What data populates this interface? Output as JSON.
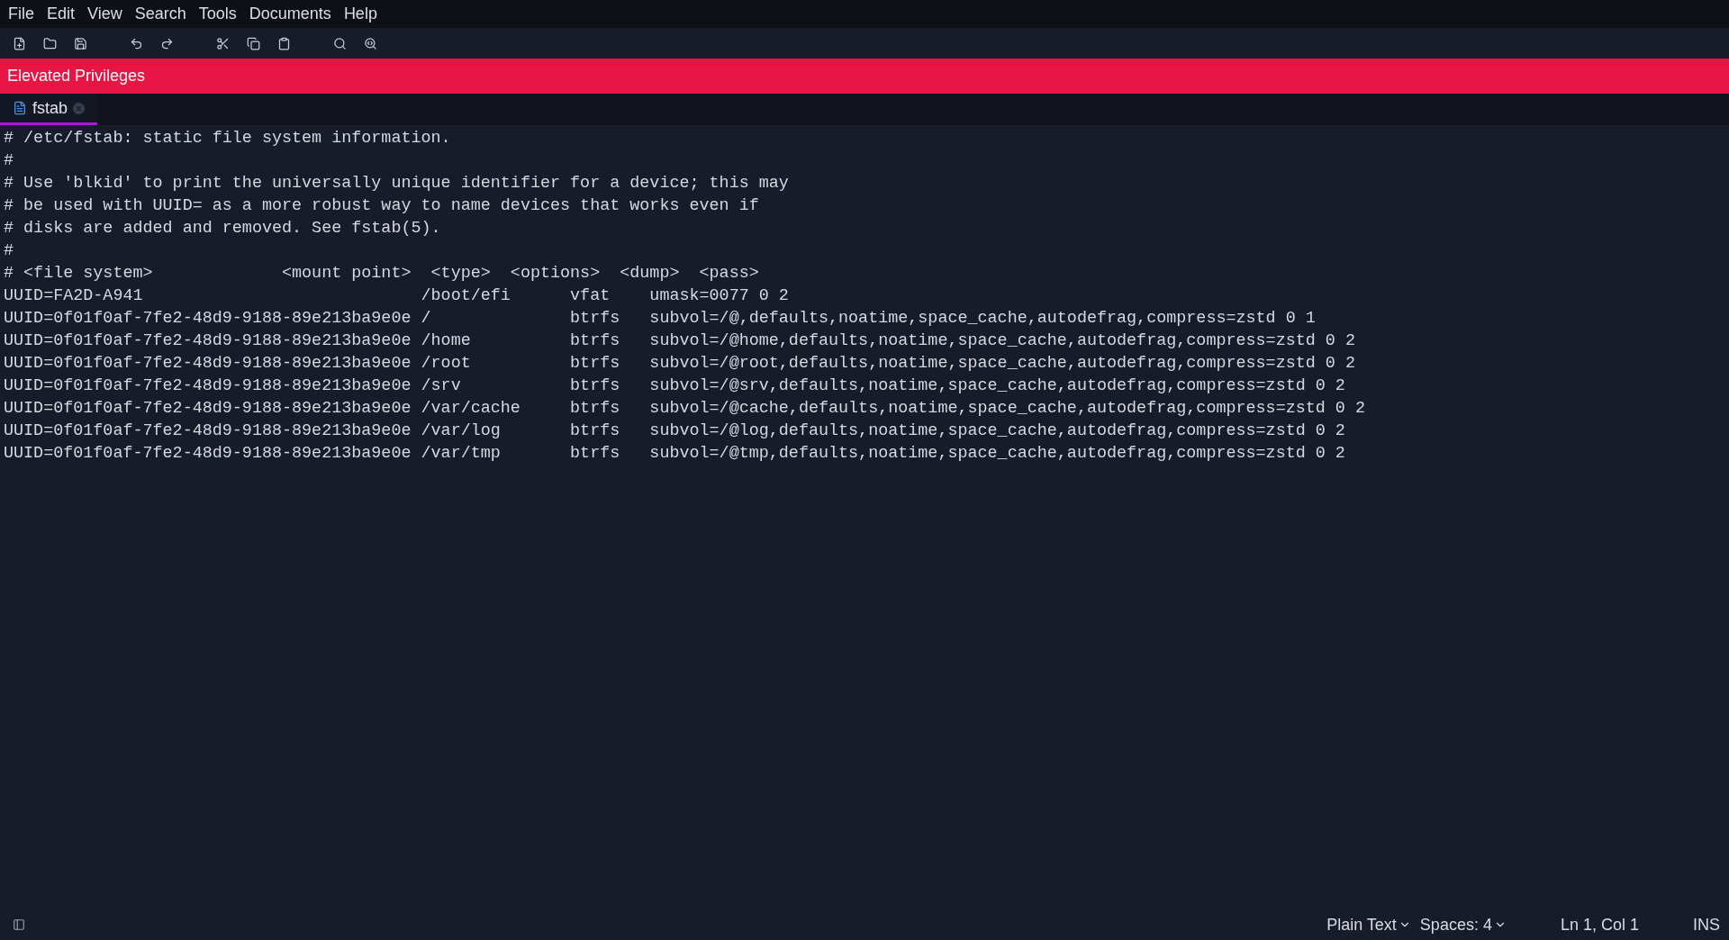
{
  "menu": [
    "File",
    "Edit",
    "View",
    "Search",
    "Tools",
    "Documents",
    "Help"
  ],
  "banner": {
    "text": "Elevated Privileges"
  },
  "tabs": [
    {
      "label": "fstab",
      "selected": true
    }
  ],
  "editor": {
    "lines": [
      "# /etc/fstab: static file system information.",
      "#",
      "# Use 'blkid' to print the universally unique identifier for a device; this may",
      "# be used with UUID= as a more robust way to name devices that works even if",
      "# disks are added and removed. See fstab(5).",
      "#",
      "# <file system>             <mount point>  <type>  <options>  <dump>  <pass>",
      "UUID=FA2D-A941                            /boot/efi      vfat    umask=0077 0 2",
      "UUID=0f01f0af-7fe2-48d9-9188-89e213ba9e0e /              btrfs   subvol=/@,defaults,noatime,space_cache,autodefrag,compress=zstd 0 1",
      "UUID=0f01f0af-7fe2-48d9-9188-89e213ba9e0e /home          btrfs   subvol=/@home,defaults,noatime,space_cache,autodefrag,compress=zstd 0 2",
      "UUID=0f01f0af-7fe2-48d9-9188-89e213ba9e0e /root          btrfs   subvol=/@root,defaults,noatime,space_cache,autodefrag,compress=zstd 0 2",
      "UUID=0f01f0af-7fe2-48d9-9188-89e213ba9e0e /srv           btrfs   subvol=/@srv,defaults,noatime,space_cache,autodefrag,compress=zstd 0 2",
      "UUID=0f01f0af-7fe2-48d9-9188-89e213ba9e0e /var/cache     btrfs   subvol=/@cache,defaults,noatime,space_cache,autodefrag,compress=zstd 0 2",
      "UUID=0f01f0af-7fe2-48d9-9188-89e213ba9e0e /var/log       btrfs   subvol=/@log,defaults,noatime,space_cache,autodefrag,compress=zstd 0 2",
      "UUID=0f01f0af-7fe2-48d9-9188-89e213ba9e0e /var/tmp       btrfs   subvol=/@tmp,defaults,noatime,space_cache,autodefrag,compress=zstd 0 2"
    ]
  },
  "status_bar": {
    "language": "Plain Text",
    "indent": "Spaces: 4",
    "position": "Ln 1, Col 1",
    "mode": "INS"
  }
}
